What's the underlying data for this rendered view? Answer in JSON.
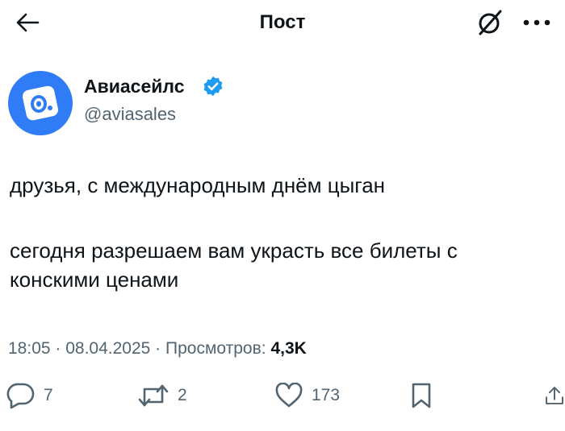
{
  "header": {
    "title": "Пост",
    "back_icon": "arrow-left-icon",
    "grok_icon": "grok-icon",
    "more_icon": "more-horizontal-icon"
  },
  "author": {
    "name": "Авиасейлс",
    "handle": "@aviasales",
    "verified": true,
    "avatar_color": "#2f7cf6",
    "verified_color": "#1d9bf0"
  },
  "tweet": {
    "line1": "друзья, с международным днём цыган",
    "line2": "сегодня разрешаем вам украсть все билеты с",
    "line3": "конскими ценами"
  },
  "meta": {
    "time": "18:05",
    "sep1": " · ",
    "date": "08.04.2025",
    "sep2": " · ",
    "views_label": "Просмотров: ",
    "views_count": "4,3K"
  },
  "actions": {
    "replies": "7",
    "reposts": "2",
    "likes": "173"
  },
  "colors": {
    "text": "#0f1419",
    "secondary": "#536471",
    "accent": "#1d9bf0"
  }
}
